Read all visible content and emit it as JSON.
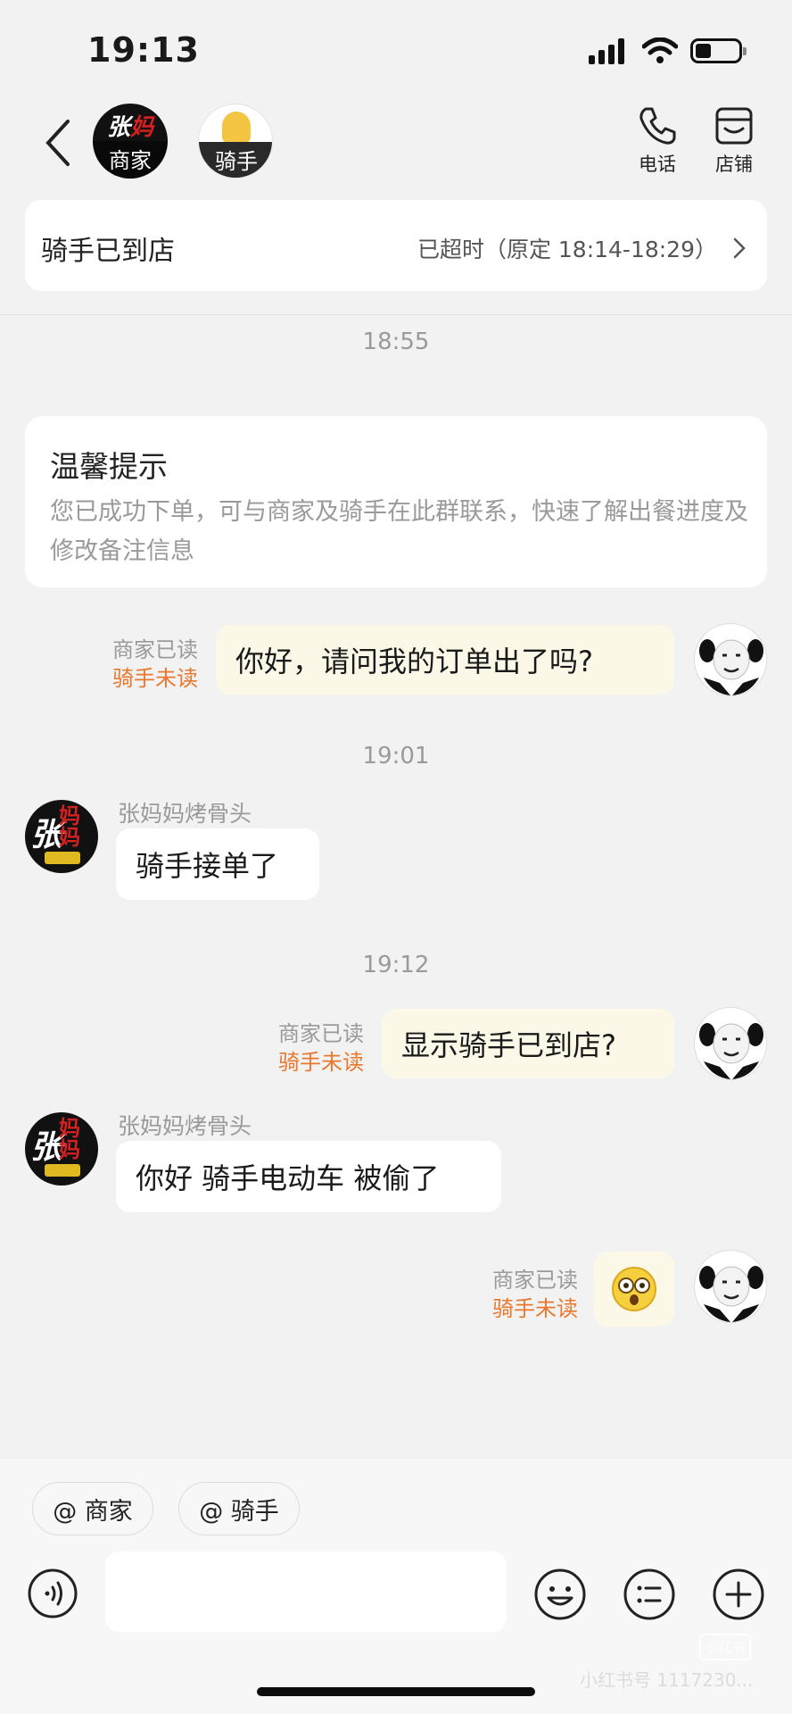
{
  "status_bar": {
    "time": "19:13"
  },
  "header": {
    "merchant_avatar_logo_main": "张",
    "merchant_avatar_logo_accent": "妈",
    "merchant_avatar_label": "商家",
    "rider_avatar_label": "骑手",
    "phone_label": "电话",
    "shop_label": "店铺"
  },
  "order_status": {
    "title": "骑手已到店",
    "detail": "已超时（原定 18:14-18:29）"
  },
  "messages": {
    "ts1": "18:55",
    "tip_title": "温馨提示",
    "tip_body": "您已成功下单，可与商家及骑手在此群联系，快速了解出餐进度及修改备注信息",
    "m1_read_merchant": "商家已读",
    "m1_read_rider": "骑手未读",
    "m1_text": "你好，请问我的订单出了吗?",
    "ts2": "19:01",
    "m2_sender": "张妈妈烤骨头",
    "m2_text": "骑手接单了",
    "ts3": "19:12",
    "m3_read_merchant": "商家已读",
    "m3_read_rider": "骑手未读",
    "m3_text": "显示骑手已到店?",
    "m4_sender": "张妈妈烤骨头",
    "m4_text": "你好 骑手电动车 被偷了",
    "m5_read_merchant": "商家已读",
    "m5_read_rider": "骑手未读",
    "m5_emoji": "shocked-face-emoji"
  },
  "composer": {
    "mention_merchant": "@ 商家",
    "mention_rider": "@ 骑手",
    "input_value": ""
  },
  "watermark": {
    "logo": "小红书",
    "id_text": "小红书号 1117230..."
  },
  "colors": {
    "unread_orange": "#e8782d",
    "outgoing_bubble": "#fbf8e8",
    "background": "#f2f2f2"
  }
}
